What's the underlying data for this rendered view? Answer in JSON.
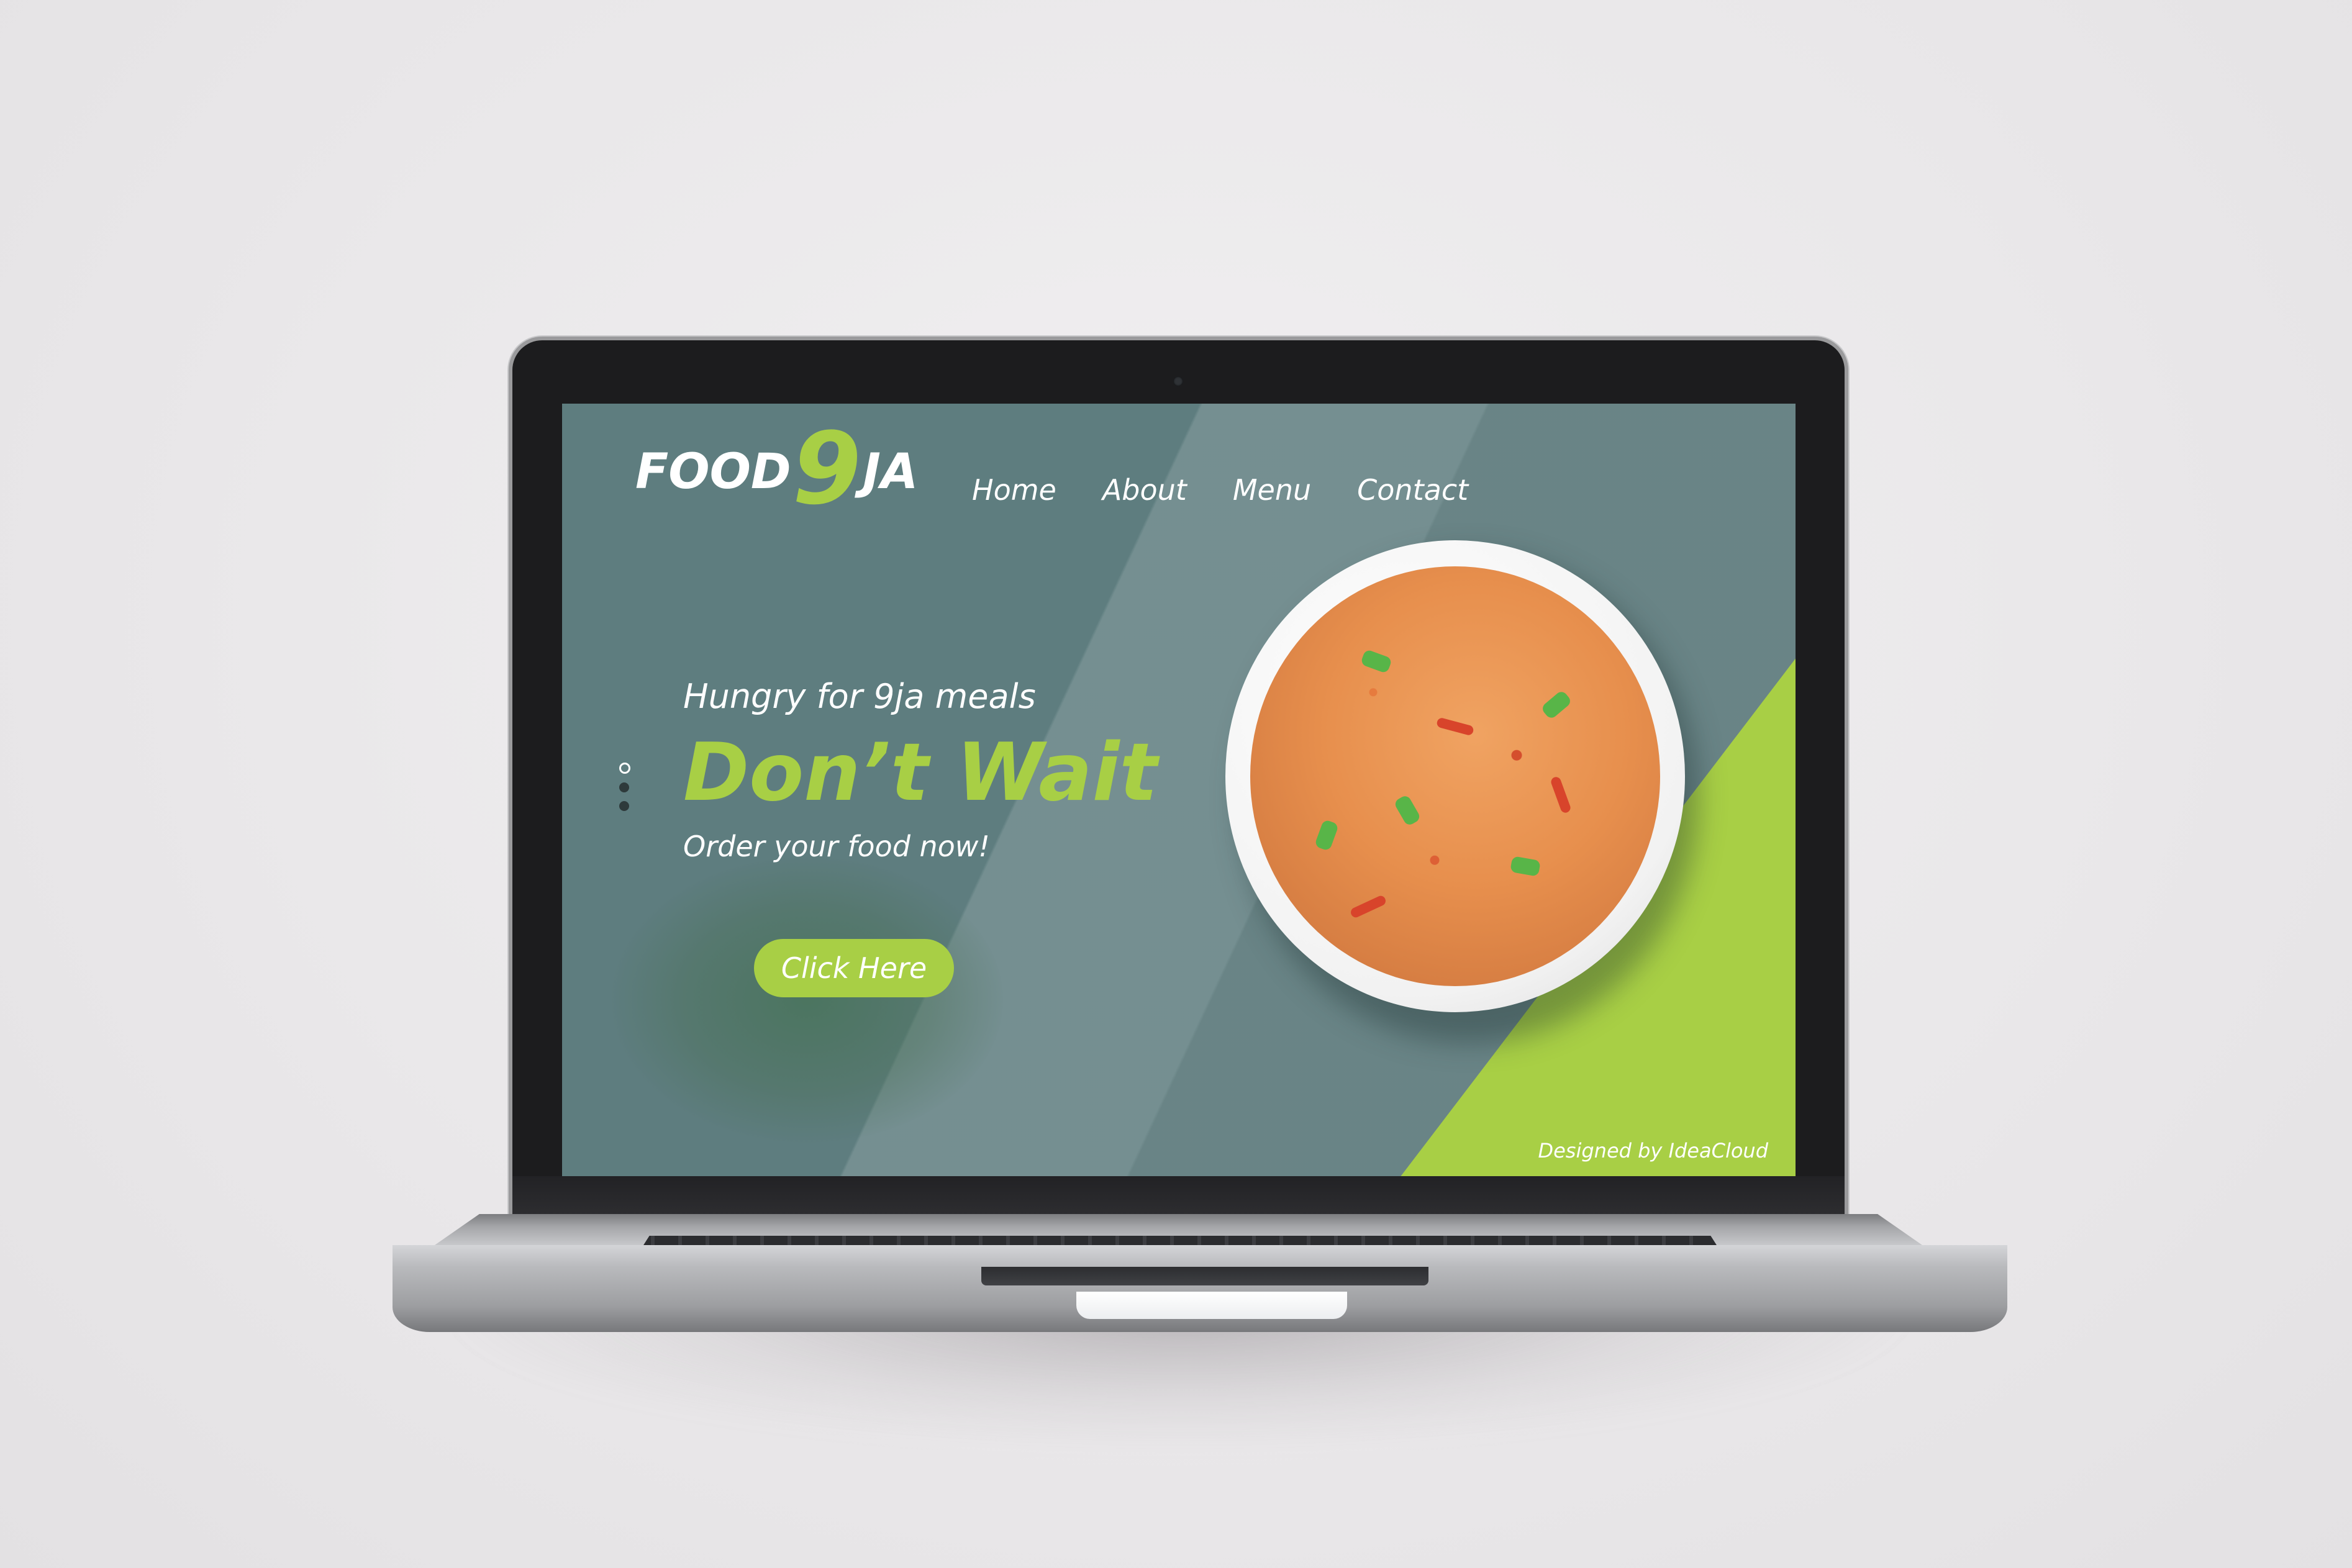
{
  "site": {
    "logo": {
      "text_before": "FOOD",
      "digit": "9",
      "text_after": "JA"
    },
    "nav": [
      {
        "label": "Home"
      },
      {
        "label": "About"
      },
      {
        "label": "Menu"
      },
      {
        "label": "Contact"
      }
    ],
    "hero": {
      "subtitle": "Hungry for 9ja meals",
      "title": "Don’t Wait",
      "tagline": "Order your food now!",
      "cta_label": "Click Here"
    },
    "slider": {
      "count": 3,
      "active_index": 0
    },
    "credit": "Designed by IdeaCloud"
  },
  "colors": {
    "brand_green": "#a8cf45",
    "background_teal": "#5e7d7f",
    "text_white": "#ffffff"
  }
}
